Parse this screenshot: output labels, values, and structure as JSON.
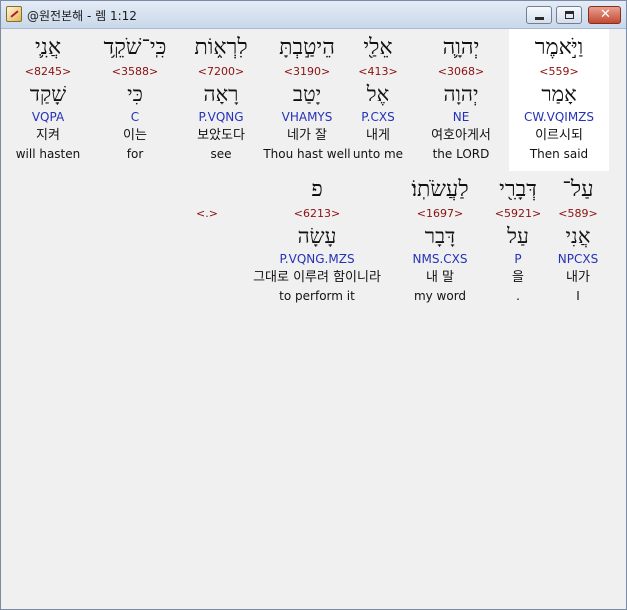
{
  "window": {
    "title": "@원전본해 - 렘 1:12",
    "minimize_icon": "minimize-icon",
    "maximize_icon": "maximize-icon",
    "close_icon": "close-icon",
    "close_glyph": "✕"
  },
  "rows": [
    {
      "words": [
        {
          "heb": "וַיֹּ֣אמֶר",
          "strong": "<559>",
          "lemma": "אָמַר",
          "morph": "CW.VQIMZS",
          "korean": "이르시되",
          "english": "Then said",
          "highlight": true
        },
        {
          "heb": "יְהוָ֛ה",
          "strong": "<3068>",
          "lemma": "יְהוָה",
          "morph": "NE",
          "korean": "여호아게서",
          "english": "the LORD",
          "highlight": false
        },
        {
          "heb": "אֵלַ֖י",
          "strong": "<413>",
          "lemma": "אֶל",
          "morph": "P.CXS",
          "korean": "내게",
          "english": "unto me",
          "highlight": false
        },
        {
          "heb": "הֵיטַ֣בְתָּ",
          "strong": "<3190>",
          "lemma": "יָטַב",
          "morph": "VHAMYS",
          "korean": "네가 잘",
          "english": "Thou hast well",
          "highlight": false
        },
        {
          "heb": "לִרְא֑וֹת",
          "strong": "<7200>",
          "lemma": "רָאָה",
          "morph": "P.VQNG",
          "korean": "보았도다",
          "english": "see",
          "highlight": false
        },
        {
          "heb": "כִּֽי־שֹׁקֵ֥ד",
          "strong": "<3588>",
          "lemma": "כִּי",
          "morph": "C",
          "korean": "이는",
          "english": "for",
          "highlight": false
        },
        {
          "heb": "אֲנִ֛י",
          "strong": "<8245>",
          "lemma": "שָׁקַד",
          "morph": "VQPA",
          "korean": "지켜",
          "english": "will hasten",
          "highlight": false
        }
      ]
    },
    {
      "words": [
        {
          "heb": "עַל־",
          "strong": "<589>",
          "lemma": "אֲנִי",
          "morph": "NPCXS",
          "korean": "내가",
          "english": "I",
          "highlight": false
        },
        {
          "heb": "דְּבָרִ֖י",
          "strong": "<5921>",
          "lemma": "עַל",
          "morph": "P",
          "korean": "을",
          "english": ".",
          "highlight": false
        },
        {
          "heb": "לַעֲשֹׂתֽוֹ׃",
          "strong": "<1697>",
          "lemma": "דָּבָר",
          "morph": "NMS.CXS",
          "korean": "내 말",
          "english": "my word",
          "highlight": false
        },
        {
          "heb": "פ",
          "strong": "<6213>",
          "lemma": "עָשָׂה",
          "morph": "P.VQNG.MZS",
          "korean": "그대로 이루려 함이니라",
          "english": "to perform it",
          "highlight": false
        },
        {
          "heb": "",
          "strong": "<.>",
          "lemma": "",
          "morph": "",
          "korean": "",
          "english": "",
          "highlight": false
        }
      ]
    }
  ]
}
